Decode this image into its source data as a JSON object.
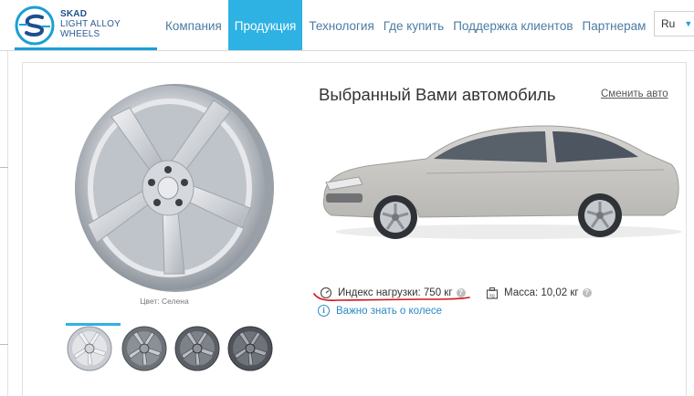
{
  "brand": {
    "line1": "SKAD",
    "line2": "LIGHT ALLOY",
    "line3": "WHEELS",
    "accent": "#2eb2e3"
  },
  "nav": {
    "items": [
      {
        "label": "Компания"
      },
      {
        "label": "Продукция",
        "active": true
      },
      {
        "label": "Технология"
      },
      {
        "label": "Где купить"
      },
      {
        "label": "Поддержка клиентов"
      },
      {
        "label": "Партнерам"
      }
    ]
  },
  "language": {
    "selected": "Ru"
  },
  "product": {
    "color_caption": "Цвет: Селена",
    "thumbnails": [
      "Селена",
      "variant-2",
      "variant-3",
      "variant-4"
    ]
  },
  "vehicle": {
    "title": "Выбранный Вами автомобиль",
    "change_label": "Сменить авто"
  },
  "specs": {
    "load_index": "Индекс нагрузки: 750 кг",
    "mass": "Масса: 10,02 кг",
    "help_glyph": "?"
  },
  "info_link": "Важно знать о колесе",
  "colors": {
    "nav_text": "#4b7ca3",
    "active_bg": "#2eb2e3",
    "link": "#2a8bc5",
    "annotation": "#d7131a"
  }
}
